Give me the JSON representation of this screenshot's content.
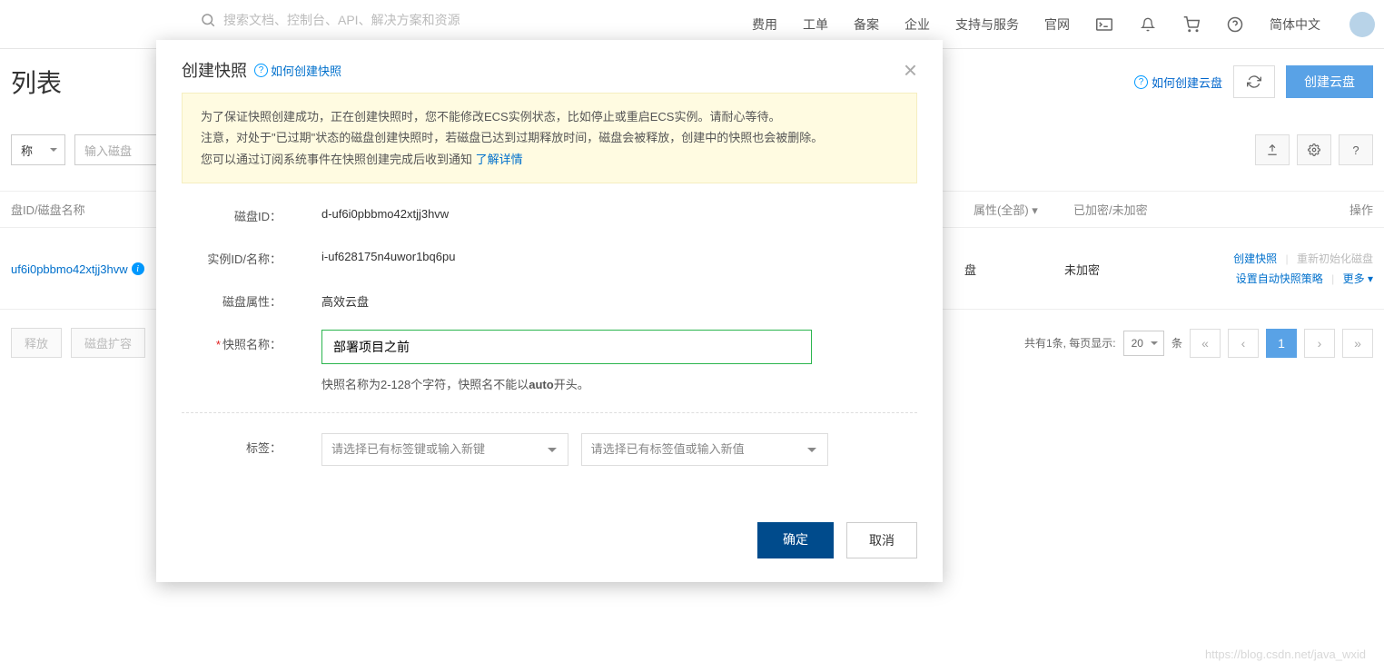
{
  "top_nav": {
    "search_placeholder": "搜索文档、控制台、API、解决方案和资源",
    "items": [
      "费用",
      "工单",
      "备案",
      "企业",
      "支持与服务",
      "官网"
    ],
    "lang": "简体中文"
  },
  "page": {
    "title_suffix": "列表",
    "help_create_disk": "如何创建云盘",
    "create_disk_btn": "创建云盘"
  },
  "filter": {
    "select_tail": "称",
    "input_placeholder": "输入磁盘"
  },
  "table": {
    "col_id": "盘ID/磁盘名称",
    "col_attr": "属性(全部)",
    "col_enc": "已加密/未加密",
    "col_op": "操作"
  },
  "row": {
    "disk_id_display": "uf6i0pbbmo42xtjj3hvw",
    "attr_tail": "盘",
    "encrypted": "未加密",
    "actions": {
      "create_snapshot": "创建快照",
      "reinit": "重新初始化磁盘",
      "auto_policy": "设置自动快照策略",
      "more": "更多"
    }
  },
  "bottom": {
    "btn_release": "释放",
    "btn_resize": "磁盘扩容",
    "total_text_prefix": "共有1条, 每页显示:",
    "page_size": "20",
    "unit": "条",
    "current_page": "1"
  },
  "modal": {
    "title": "创建快照",
    "help_link": "如何创建快照",
    "alert_line1": "为了保证快照创建成功，正在创建快照时，您不能修改ECS实例状态，比如停止或重启ECS实例。请耐心等待。",
    "alert_line2": "注意，对处于\"已过期\"状态的磁盘创建快照时，若磁盘已达到过期释放时间，磁盘会被释放，创建中的快照也会被删除。",
    "alert_line3_prefix": "您可以通过订阅系统事件在快照创建完成后收到通知 ",
    "alert_learn_more": "了解详情",
    "labels": {
      "disk_id": "磁盘ID：",
      "instance": "实例ID/名称：",
      "disk_attr": "磁盘属性：",
      "snapshot_name": "快照名称：",
      "tag": "标签："
    },
    "values": {
      "disk_id": "d-uf6i0pbbmo42xtjj3hvw",
      "instance": "i-uf628175n4uwor1bq6pu",
      "disk_attr": "高效云盘",
      "snapshot_name": "部署项目之前"
    },
    "hint_prefix": "快照名称为2-128个字符，快照名不能以",
    "hint_bold": "auto",
    "hint_suffix": "开头。",
    "tag_key_placeholder": "请选择已有标签键或输入新键",
    "tag_val_placeholder": "请选择已有标签值或输入新值",
    "confirm": "确定",
    "cancel": "取消"
  },
  "watermark": "https://blog.csdn.net/java_wxid"
}
